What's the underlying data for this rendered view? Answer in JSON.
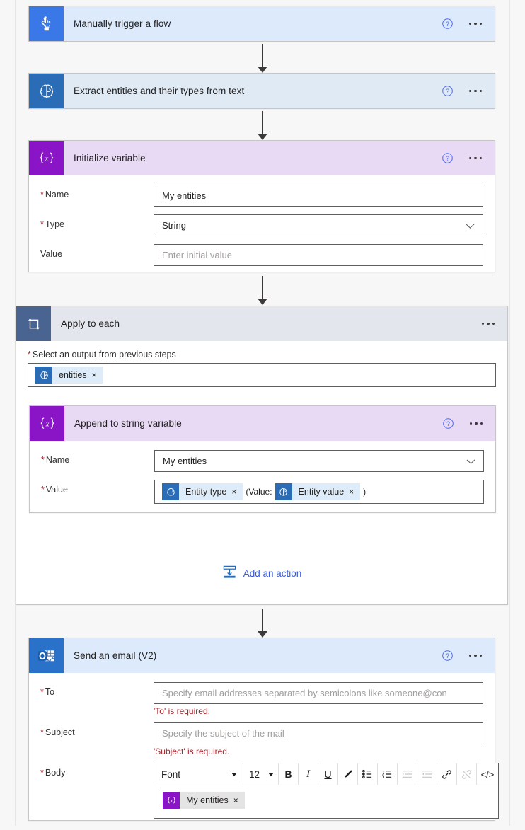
{
  "colors": {
    "accent_blue": "#3b78e7",
    "ai_blue": "#2a6cb5",
    "variable_purple": "#8a15c7",
    "loop_slate": "#4a6491",
    "outlook_blue": "#2a72c9",
    "error_red": "#a4262c",
    "link_blue": "#3b5bdb"
  },
  "steps": [
    {
      "id": "trigger",
      "title": "Manually trigger a flow",
      "icon": "tap-hand-icon",
      "help_icon": "help-circle-icon",
      "more_icon": "ellipsis-icon"
    },
    {
      "id": "extract-entities",
      "title": "Extract entities and their types from text",
      "icon": "brain-ai-icon",
      "help_icon": "help-circle-icon",
      "more_icon": "ellipsis-icon"
    }
  ],
  "initialize_variable": {
    "title": "Initialize variable",
    "icon": "variable-braces-icon",
    "help_icon": "help-circle-icon",
    "more_icon": "ellipsis-icon",
    "fields": {
      "name": {
        "label": "Name",
        "required": true,
        "value": "My entities"
      },
      "type": {
        "label": "Type",
        "required": true,
        "value": "String",
        "chevron": "chevron-down-icon"
      },
      "value": {
        "label": "Value",
        "required": false,
        "placeholder": "Enter initial value"
      }
    }
  },
  "apply_to_each": {
    "title": "Apply to each",
    "icon": "loop-repeat-icon",
    "more_icon": "ellipsis-icon",
    "select_output": {
      "label": "Select an output from previous steps",
      "required": true,
      "token": {
        "text": "entities",
        "icon": "brain-ai-icon",
        "remove": "×"
      }
    },
    "add_action": {
      "label": "Add an action",
      "icon": "add-action-icon"
    }
  },
  "append_to_string": {
    "title": "Append to string variable",
    "icon": "variable-braces-icon",
    "help_icon": "help-circle-icon",
    "more_icon": "ellipsis-icon",
    "fields": {
      "name": {
        "label": "Name",
        "required": true,
        "value": "My entities",
        "chevron": "chevron-down-icon"
      },
      "value": {
        "label": "Value",
        "required": true,
        "parts": [
          {
            "kind": "token",
            "text": "Entity type",
            "icon": "brain-ai-icon",
            "remove": "×"
          },
          {
            "kind": "text",
            "text": "(Value:"
          },
          {
            "kind": "token",
            "text": "Entity value",
            "icon": "brain-ai-icon",
            "remove": "×"
          },
          {
            "kind": "text",
            "text": ")"
          }
        ]
      }
    }
  },
  "send_email": {
    "title": "Send an email (V2)",
    "icon": "outlook-icon",
    "help_icon": "help-circle-icon",
    "more_icon": "ellipsis-icon",
    "fields": {
      "to": {
        "label": "To",
        "required": true,
        "placeholder": "Specify email addresses separated by semicolons like someone@con",
        "error": "'To' is required."
      },
      "subject": {
        "label": "Subject",
        "required": true,
        "placeholder": "Specify the subject of the mail",
        "error": "'Subject' is required."
      },
      "body": {
        "label": "Body",
        "required": true,
        "token": {
          "text": "My entities",
          "icon": "variable-braces-icon",
          "remove": "×"
        }
      }
    },
    "rte_toolbar": {
      "font_family": {
        "value": "Font",
        "caret": "caret-down-icon"
      },
      "font_size": {
        "value": "12",
        "caret": "caret-down-icon"
      },
      "buttons": [
        {
          "name": "bold-icon",
          "glyph": "B"
        },
        {
          "name": "italic-icon",
          "glyph": "I"
        },
        {
          "name": "underline-icon",
          "glyph": "U"
        },
        {
          "name": "text-color-pencil-icon",
          "glyph": "✎"
        },
        {
          "name": "bulleted-list-icon",
          "glyph": "☰"
        },
        {
          "name": "numbered-list-icon",
          "glyph": "☰"
        },
        {
          "name": "indent-icon",
          "glyph": "☰",
          "disabled": true
        },
        {
          "name": "outdent-icon",
          "glyph": "☰",
          "disabled": true
        },
        {
          "name": "link-icon",
          "glyph": "🔗"
        },
        {
          "name": "unlink-icon",
          "glyph": "🔗",
          "disabled": true
        },
        {
          "name": "code-view-icon",
          "glyph": "</>"
        }
      ]
    }
  }
}
